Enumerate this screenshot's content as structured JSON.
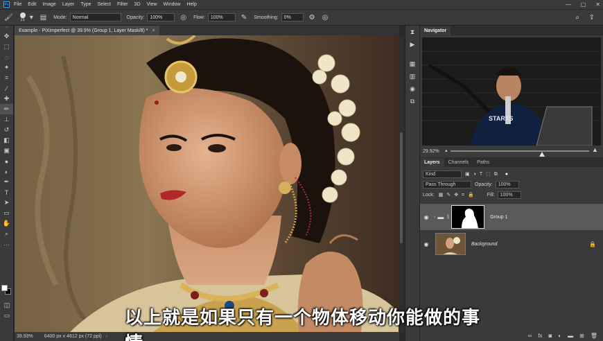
{
  "menu": [
    "File",
    "Edit",
    "Image",
    "Layer",
    "Type",
    "Select",
    "Filter",
    "3D",
    "View",
    "Window",
    "Help"
  ],
  "options": {
    "brush_size": "21",
    "mode_label": "Mode:",
    "mode_value": "Normal",
    "opacity_label": "Opacity:",
    "opacity_value": "100%",
    "flow_label": "Flow:",
    "flow_value": "100%",
    "smoothing_label": "Smoothing:",
    "smoothing_value": "0%"
  },
  "document": {
    "tab_title": "Example - PiXimperfect @ 39.9% (Group 1, Layer Mask/8) *",
    "close_glyph": "×"
  },
  "status": {
    "zoom": "39.93%",
    "info": "6400 px x 4612 px (72 ppi)"
  },
  "navigator": {
    "tab": "Navigator",
    "zoom": "29.92%"
  },
  "layers": {
    "tabs": [
      "Layers",
      "Channels",
      "Paths"
    ],
    "kind_label": "Kind",
    "blend_mode": "Pass Through",
    "opacity_label": "Opacity:",
    "opacity_value": "100%",
    "lock_label": "Lock:",
    "fill_label": "Fill:",
    "fill_value": "100%",
    "items": [
      {
        "name": "Group 1",
        "selected": true
      },
      {
        "name": "Background",
        "selected": false
      }
    ]
  },
  "subtitle": "以上就是如果只有一个物体移动你能做的事情",
  "icons": {
    "brush": "brush-icon",
    "search": "search-icon",
    "share": "share-icon"
  },
  "colors": {
    "foreground": "#ffffff",
    "background": "#000000",
    "accent": "#31a8ff"
  }
}
